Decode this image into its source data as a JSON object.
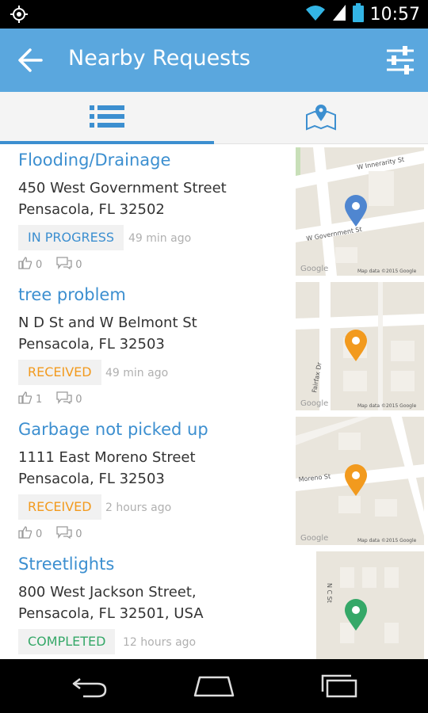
{
  "status_bar": {
    "time": "10:57",
    "icons": [
      "location-icon",
      "wifi-icon",
      "signal-icon",
      "battery-icon"
    ]
  },
  "app_bar": {
    "title": "Nearby Requests",
    "back_icon": "arrow-left-icon",
    "filter_icon": "sliders-icon"
  },
  "tabs": [
    {
      "name": "list",
      "icon": "list-icon",
      "active": true
    },
    {
      "name": "map",
      "icon": "map-pin-icon",
      "active": false
    }
  ],
  "colors": {
    "app_bar": "#5aa7de",
    "accent": "#3c8fd0",
    "in_progress": "#3c8fd0",
    "received": "#f29a1e",
    "completed": "#35a868"
  },
  "requests": [
    {
      "title": "Flooding/Drainage",
      "address_line1": "450 West Government Street",
      "address_line2": "Pensacola, FL 32502",
      "status": "IN PROGRESS",
      "status_color": "#3c8fd0",
      "time_ago": "49 min ago",
      "votes": "0",
      "comments": "0",
      "map": {
        "pin_color": "#4f86d0",
        "street_labels": [
          "W Innerarity St",
          "W Government St"
        ],
        "attribution": "Map data ©2015 Google",
        "logo": "Google"
      }
    },
    {
      "title": "tree problem",
      "address_line1": "N D St and W Belmont St",
      "address_line2": "Pensacola, FL 32503",
      "status": "RECEIVED",
      "status_color": "#f29a1e",
      "time_ago": "49 min ago",
      "votes": "1",
      "comments": "0",
      "map": {
        "pin_color": "#f29a1e",
        "street_labels": [
          "Fairfax Dr"
        ],
        "attribution": "Map data ©2015 Google",
        "logo": "Google"
      }
    },
    {
      "title": "Garbage not picked up",
      "address_line1": "1111 East Moreno Street",
      "address_line2": "Pensacola, FL 32503",
      "status": "RECEIVED",
      "status_color": "#f29a1e",
      "time_ago": "2 hours ago",
      "votes": "0",
      "comments": "0",
      "map": {
        "pin_color": "#f29a1e",
        "street_labels": [
          "Moreno St"
        ],
        "attribution": "Map data ©2015 Google",
        "logo": "Google"
      }
    },
    {
      "title": "Streetlights",
      "address_line1": "800 West Jackson Street,",
      "address_line2": "Pensacola, FL 32501, USA",
      "status": "COMPLETED",
      "status_color": "#35a868",
      "time_ago": "12 hours ago",
      "votes": "",
      "comments": "",
      "map": {
        "pin_color": "#35a868",
        "street_labels": [
          "N C St"
        ],
        "attribution": "",
        "logo": ""
      }
    }
  ],
  "nav_bar": {
    "buttons": [
      "back-nav-icon",
      "home-nav-icon",
      "recents-nav-icon"
    ]
  }
}
